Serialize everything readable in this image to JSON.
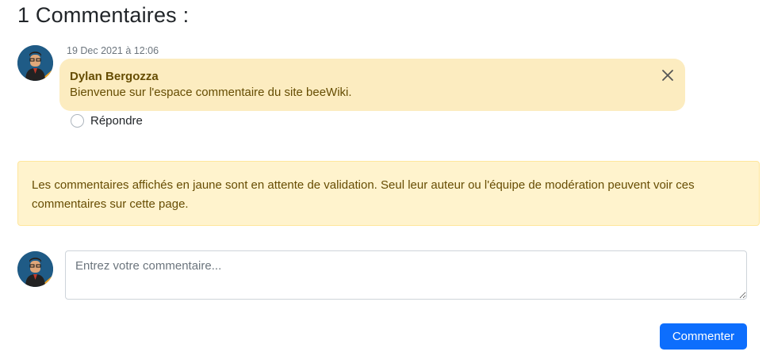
{
  "section": {
    "title": "1 Commentaires :"
  },
  "comment": {
    "date": "19 Dec 2021 à 12:06",
    "author": "Dylan Bergozza",
    "message": "Bienvenue sur l'espace commentaire du site beeWiki.",
    "close_icon": "close-icon",
    "reply_label": "Répondre"
  },
  "notice": {
    "text": "Les commentaires affichés en jaune sont en attente de validation. Seul leur auteur ou l'équipe de modération peuvent voir ces commentaires sur cette page."
  },
  "form": {
    "placeholder": "Entrez votre commentaire...",
    "value": "",
    "submit_label": "Commenter"
  },
  "colors": {
    "bubble_bg": "#fcecc0",
    "notice_bg": "#fff3cd",
    "primary": "#0d6efd",
    "warning_text": "#664d03"
  }
}
